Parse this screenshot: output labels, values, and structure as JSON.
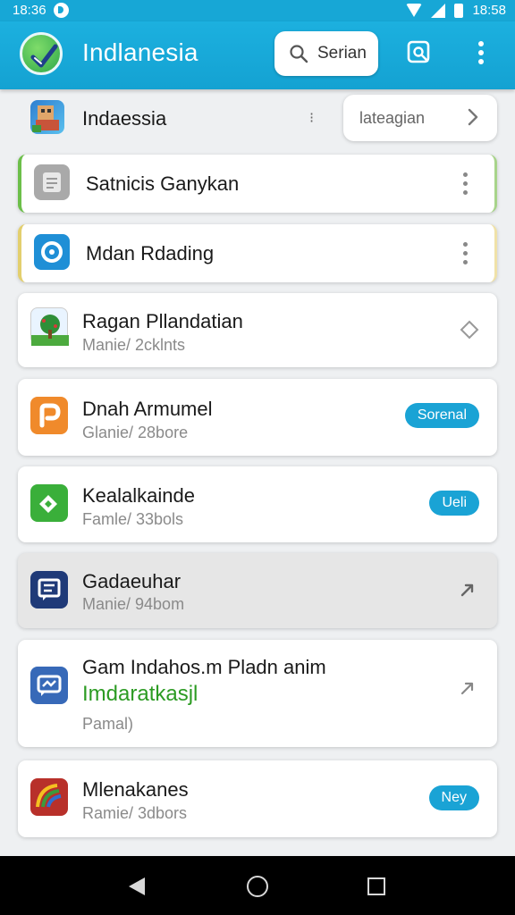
{
  "status_bar": {
    "time_left": "18:36",
    "time_right": "18:58"
  },
  "app_bar": {
    "title": "Indlanesia",
    "search_label": "Serian"
  },
  "top_row": {
    "title": "Indaessia",
    "handle": "⁝",
    "category_label": "lateagian"
  },
  "items": [
    {
      "title": "Satnicis Ganykan",
      "accent": "#6cbf4a",
      "icon": "document-icon",
      "icon_color": "#a9a9a9"
    },
    {
      "title": "Mdan Rdading",
      "accent": "#e3cf6e",
      "icon": "record-icon",
      "icon_color": "#1f8fd6"
    },
    {
      "title": "Ragan Pllandatian",
      "subtitle": "Manie/ 2cklnts",
      "icon": "tree-icon",
      "trailing": "diamond"
    },
    {
      "title": "Dnah Armumel",
      "subtitle": "Glanie/ 28bore",
      "icon": "p-icon",
      "icon_color": "#f08a2b",
      "badge": "Sorenal"
    },
    {
      "title": "Kealalkainde",
      "subtitle": "Famle/ 33bols",
      "icon": "puzzle-icon",
      "icon_color": "#3aaf3a",
      "badge": "Ueli"
    },
    {
      "title": "Gadaeuhar",
      "subtitle": "Manie/ 94bom",
      "icon": "chat-icon",
      "icon_color": "#1f3a78",
      "trailing": "arrow",
      "highlighted": true
    },
    {
      "title": "Gam Indahos.m Pladn anim",
      "title2": "Imdaratkasjl",
      "subtitle": "Pamal)",
      "icon": "message-icon",
      "icon_color": "#3769b8",
      "trailing": "arrow"
    },
    {
      "title": "Mlenakanes",
      "subtitle": "Ramie/ 3dbors",
      "icon": "gauge-icon",
      "icon_color": "#b8302a",
      "badge": "Ney"
    }
  ]
}
